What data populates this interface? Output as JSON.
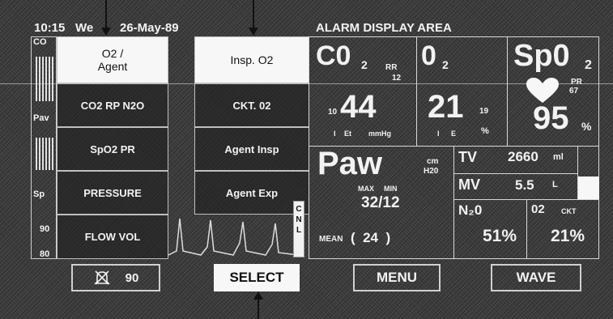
{
  "header": {
    "time": "10:15",
    "weekday": "We",
    "date": "26-May-89",
    "alarm_area_label": "ALARM DISPLAY AREA"
  },
  "left_panel": {
    "labels": [
      "CO",
      "Pav",
      "Sp"
    ],
    "scale_values": [
      "90",
      "80"
    ]
  },
  "menu_left": {
    "items": [
      "O2 /\nAgent",
      "CO2  RP  N2O",
      "SpO2 PR",
      "PRESSURE",
      "FLOW VOL"
    ],
    "selected_index": 0
  },
  "menu_right": {
    "items": [
      "Insp. O2",
      "CKT. 02",
      "Agent Insp",
      "Agent Exp"
    ],
    "selected_index": 0
  },
  "side_tab": "CNL",
  "co2_box": {
    "title": "C0",
    "sub": "2",
    "rr_label": "RR",
    "rr_value": "12",
    "small_value": "10",
    "value": "44",
    "footer_i": "I",
    "footer_et": "Et",
    "unit": "mmHg"
  },
  "o2_box": {
    "title": "0",
    "sub": "2",
    "value": "21",
    "small_value": "19",
    "footer_i": "I",
    "footer_e": "E",
    "unit": "%"
  },
  "spo2_box": {
    "title": "Sp0",
    "sub": "2",
    "pr_label": "PR",
    "pr_value": "67",
    "value": "95",
    "unit": "%"
  },
  "paw_box": {
    "title": "Paw",
    "unit_line1": "cm",
    "unit_line2": "H20",
    "max_label": "MAX",
    "min_label": "MIN",
    "maxmin_value": "32/12",
    "mean_label": "MEAN",
    "mean_value": "(  24  )"
  },
  "tv": {
    "label": "TV",
    "value": "2660",
    "unit": "ml"
  },
  "mv": {
    "label": "MV",
    "value": "5.5",
    "unit": "L"
  },
  "n2o": {
    "label": "N₂0",
    "value": "51%"
  },
  "ckt_o2": {
    "label": "02",
    "sub_label": "CKT",
    "value": "21%"
  },
  "bottom_buttons": {
    "alarm_value": "90",
    "select": "SELECT",
    "menu": "MENU",
    "wave": "WAVE"
  },
  "icons": [
    "alarm-silenced-icon",
    "heart-icon"
  ]
}
